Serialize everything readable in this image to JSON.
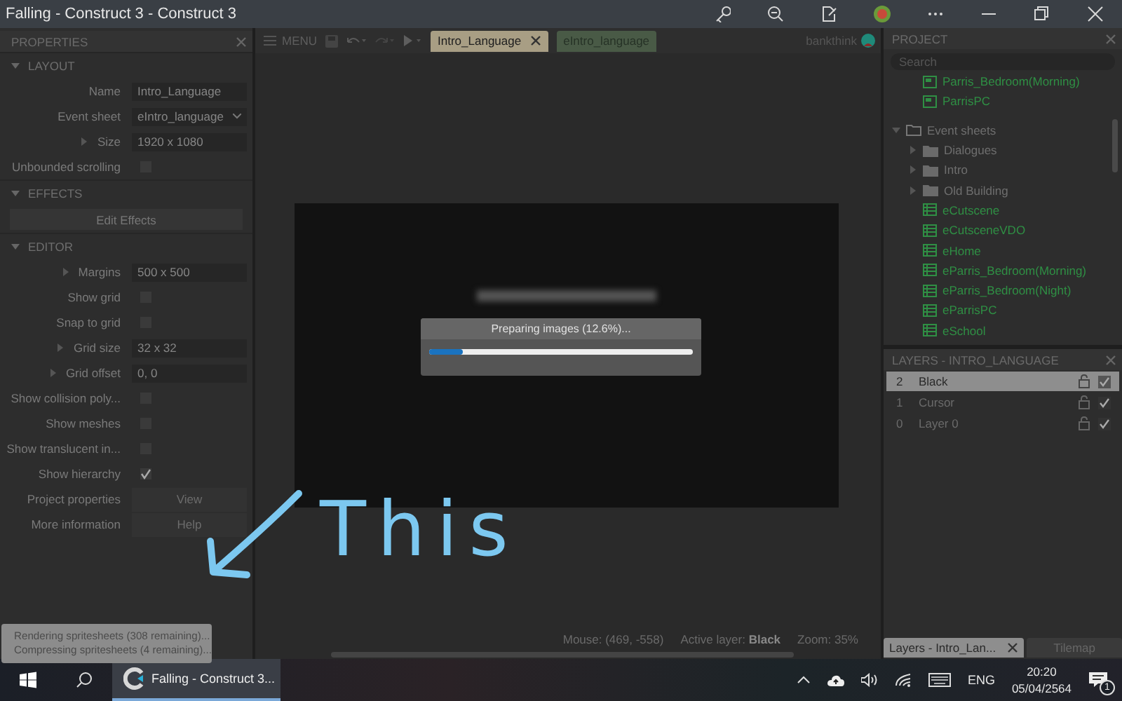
{
  "window": {
    "title": "Falling - Construct 3 - Construct 3"
  },
  "properties": {
    "title": "PROPERTIES",
    "sections": [
      {
        "title": "LAYOUT",
        "expanded": true,
        "rows": [
          {
            "kind": "text",
            "label": "Name",
            "value": "Intro_Language"
          },
          {
            "kind": "select",
            "label": "Event sheet",
            "value": "eIntro_language"
          },
          {
            "kind": "text",
            "label": "Size",
            "value": "1920 x 1080",
            "expandable": true
          },
          {
            "kind": "check",
            "label": "Unbounded scrolling",
            "checked": false
          }
        ]
      },
      {
        "title": "EFFECTS",
        "expanded": true,
        "rows": [
          {
            "kind": "wide_button",
            "label": "Edit Effects"
          }
        ]
      },
      {
        "title": "EDITOR",
        "expanded": true,
        "rows": [
          {
            "kind": "text",
            "label": "Margins",
            "value": "500 x 500",
            "expandable": true
          },
          {
            "kind": "check",
            "label": "Show grid",
            "checked": false
          },
          {
            "kind": "check",
            "label": "Snap to grid",
            "checked": false
          },
          {
            "kind": "text",
            "label": "Grid size",
            "value": "32 x 32",
            "expandable": true
          },
          {
            "kind": "text",
            "label": "Grid offset",
            "value": "0, 0",
            "expandable": true
          },
          {
            "kind": "check",
            "label": "Show collision poly...",
            "checked": false
          },
          {
            "kind": "check",
            "label": "Show meshes",
            "checked": false
          },
          {
            "kind": "check",
            "label": "Show translucent in...",
            "checked": false
          },
          {
            "kind": "check",
            "label": "Show hierarchy",
            "checked": true
          },
          {
            "kind": "link_button",
            "label": "Project properties",
            "button": "View"
          },
          {
            "kind": "link_button",
            "label": "More information",
            "button": "Help"
          }
        ]
      }
    ]
  },
  "build_status": [
    "Rendering spritesheets (308 remaining)...",
    "Compressing spritesheets (4 remaining)..."
  ],
  "editor": {
    "menu_label": "MENU",
    "tabs": [
      {
        "label": "Intro_Language",
        "kind": "layout",
        "selected": true
      },
      {
        "label": "eIntro_language",
        "kind": "event_sheet",
        "selected": false
      }
    ],
    "user": "bankthink",
    "dialog": {
      "message": "Preparing images (12.6%)...",
      "level": 0.126
    },
    "status": {
      "mouse": "Mouse: (469, -558)",
      "active_layer": "Active layer: **Black**",
      "zoom": "Zoom: 35%"
    }
  },
  "annotation": {
    "text": "This"
  },
  "project": {
    "title": "PROJECT",
    "search_placeholder": "Search",
    "layouts_tail": [
      {
        "label": "Parris_Bedroom(Morning)",
        "kind": "layout"
      },
      {
        "label": "ParrisPC",
        "kind": "layout"
      }
    ],
    "tree": [
      {
        "label": "Event sheets",
        "kind": "folder",
        "expanded": true,
        "children": [
          {
            "label": "Dialogues",
            "kind": "folder",
            "expanded": false
          },
          {
            "label": "Intro",
            "kind": "folder",
            "expanded": false
          },
          {
            "label": "Old Building",
            "kind": "folder",
            "expanded": false
          },
          {
            "label": "eCutscene",
            "kind": "event_sheet"
          },
          {
            "label": "eCutsceneVDO",
            "kind": "event_sheet"
          },
          {
            "label": "eHome",
            "kind": "event_sheet"
          },
          {
            "label": "eParris_Bedroom(Morning)",
            "kind": "event_sheet"
          },
          {
            "label": "eParris_Bedroom(Night)",
            "kind": "event_sheet"
          },
          {
            "label": "eParrisPC",
            "kind": "event_sheet"
          },
          {
            "label": "eSchool",
            "kind": "event_sheet"
          }
        ]
      }
    ]
  },
  "layers": {
    "title": "LAYERS - INTRO_LANGUAGE",
    "rows": [
      {
        "index": "2",
        "name": "Black",
        "selected": true,
        "visible": true
      },
      {
        "index": "1",
        "name": "Cursor",
        "selected": false,
        "visible": true
      },
      {
        "index": "0",
        "name": "Layer 0",
        "selected": false,
        "visible": true
      }
    ],
    "tabs": [
      {
        "label": "Layers - Intro_Lan...",
        "selected": true
      },
      {
        "label": "Tilemap",
        "selected": false
      }
    ]
  },
  "taskbar": {
    "app": "Falling - Construct 3...",
    "language": "ENG",
    "time": "20:20",
    "date": "05/04/2564",
    "notifications": "1"
  }
}
